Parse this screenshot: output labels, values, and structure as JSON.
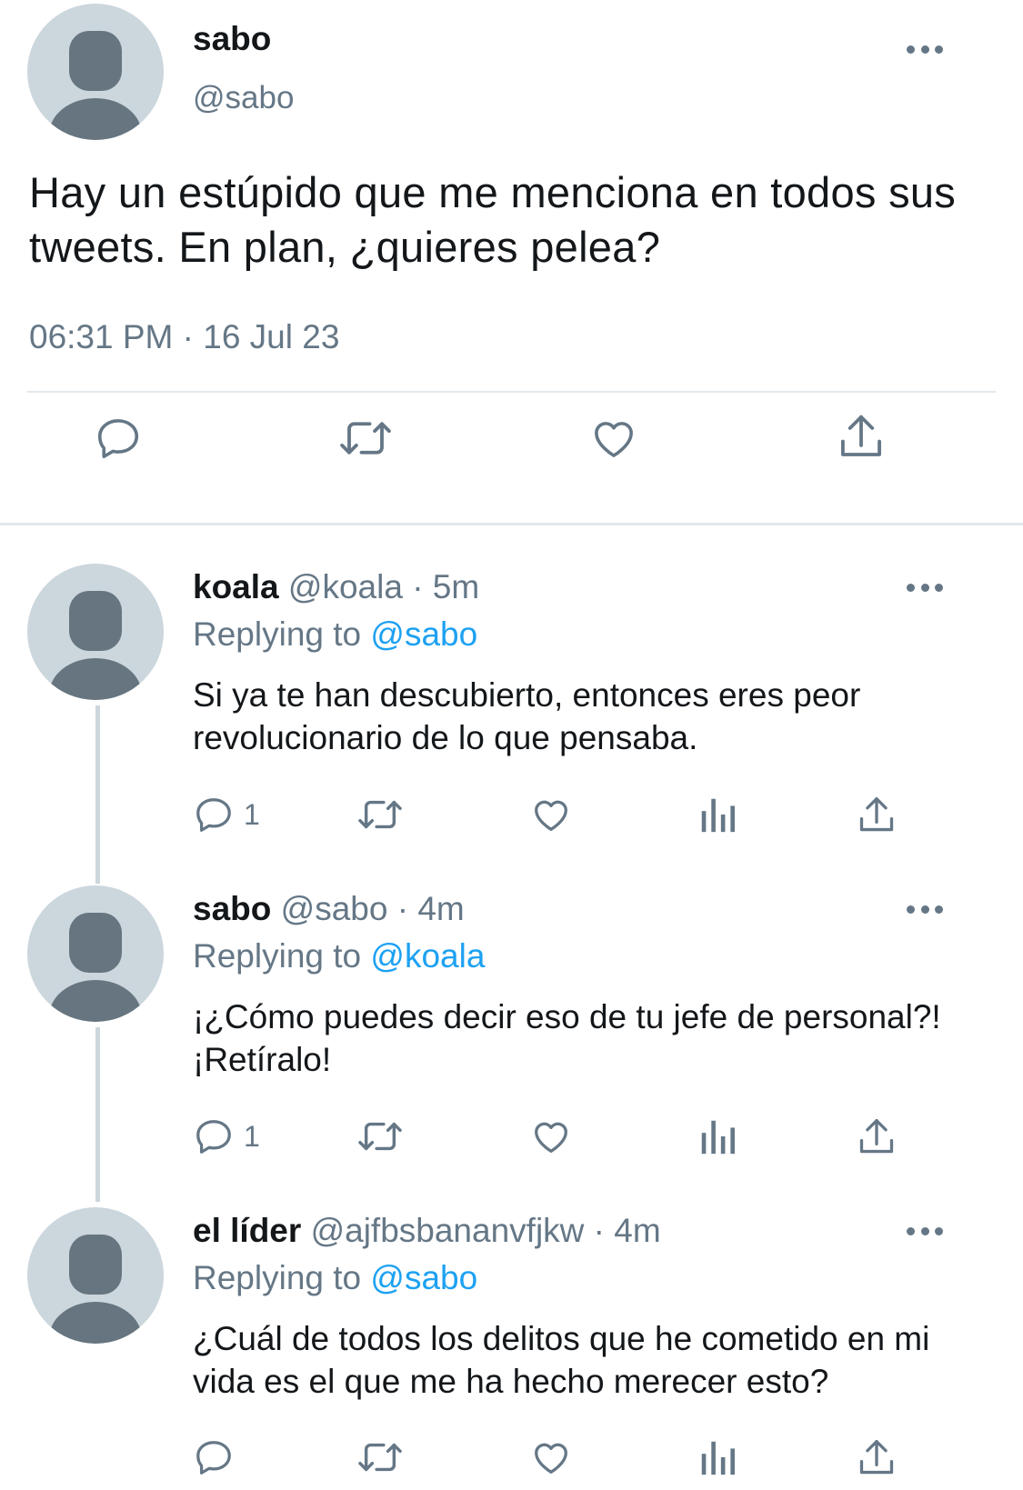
{
  "main_tweet": {
    "name": "sabo",
    "handle": "@sabo",
    "text": "Hay un estúpido que me menciona en todos sus tweets. En plan, ¿quieres pelea?",
    "timestamp": "06:31 PM · 16 Jul 23",
    "actions": [
      "reply-icon",
      "retweet-icon",
      "like-icon",
      "share-icon"
    ]
  },
  "replies": [
    {
      "name": "koala",
      "meta": "@koala · 5m",
      "replying_label": "Replying to",
      "replying_to": "@sabo",
      "text": "Si ya te han descubierto, entonces eres peor revolucionario de lo que pensaba.",
      "reply_count": "1"
    },
    {
      "name": "sabo",
      "meta": "@sabo · 4m",
      "replying_label": "Replying to",
      "replying_to": "@koala",
      "text": "¡¿Cómo puedes decir eso de tu jefe de personal?! ¡Retíralo!",
      "reply_count": "1"
    },
    {
      "name": "el líder",
      "meta": "@ajfbsbananvfjkw · 4m",
      "replying_label": "Replying to",
      "replying_to": "@sabo",
      "text": "¿Cuál de todos los delitos que he cometido en mi vida es el que me ha hecho merecer esto?",
      "reply_count": ""
    }
  ],
  "colors": {
    "text": "#14171a",
    "secondary": "#657786",
    "link": "#1da1f2",
    "avatar_bg": "#ccd6dd",
    "avatar_fg": "#66757f",
    "divider": "#e1e8ed"
  }
}
